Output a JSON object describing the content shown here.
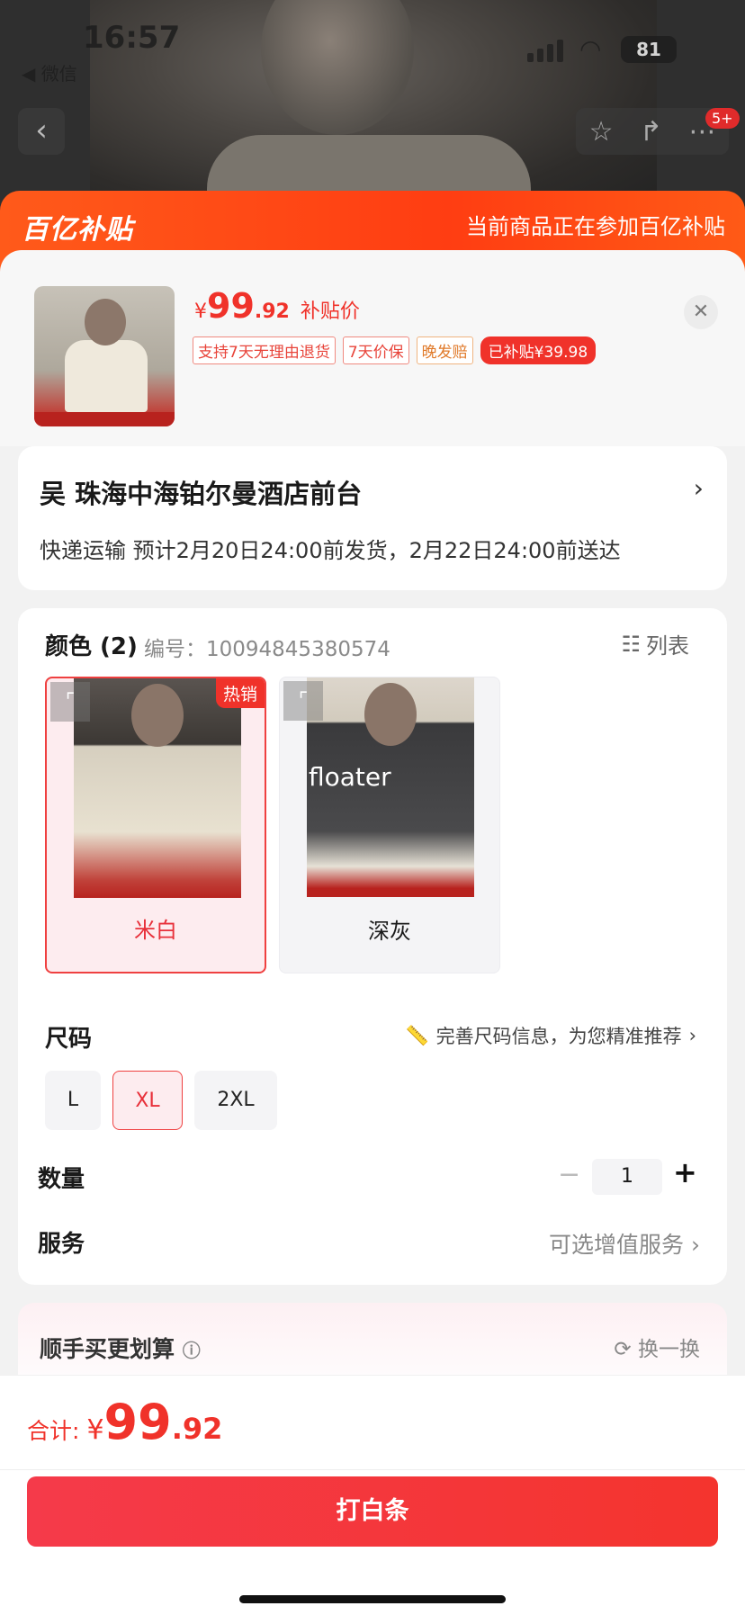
{
  "status": {
    "time": "16:57",
    "back_app": "◀ 微信",
    "battery": "81"
  },
  "nav": {
    "badge": "5+"
  },
  "banner": {
    "logo": "百亿补贴",
    "text": "当前商品正在参加百亿补贴"
  },
  "product": {
    "price_currency": "¥",
    "price_int": "99",
    "price_dec": ".92",
    "price_label": "补贴价",
    "tags": [
      "支持7天无理由退货",
      "7天价保",
      "晚发赔",
      "已补贴¥39.98"
    ]
  },
  "address": {
    "name": "吴  珠海中海铂尔曼酒店前台",
    "shipping": "快递运输 预计2月20日24:00前发货，2月22日24:00前送达"
  },
  "spec": {
    "color_title": "颜色 (2)",
    "sku": "编号：10094845380574",
    "list_label": "列表",
    "colors": [
      {
        "label": "米白",
        "hot": "热销",
        "selected": true
      },
      {
        "label": "深灰",
        "overlay": "floater",
        "selected": false
      }
    ],
    "size_title": "尺码",
    "size_hint": "完善尺码信息，为您精准推荐",
    "sizes": [
      "L",
      "XL",
      "2XL"
    ],
    "selected_size": "XL",
    "qty_title": "数量",
    "qty_value": "1",
    "service_title": "服务",
    "service_value": "可选增值服务"
  },
  "extra": {
    "title": "顺手买更划算",
    "refresh": "换一换"
  },
  "footer": {
    "total_label": "合计:",
    "currency": "¥",
    "total_int": "99",
    "total_dec": ".92",
    "pay_button": "打白条"
  },
  "colors": {
    "accent": "#f0322a",
    "banner": "#ff4a15",
    "selected_bg": "#fdecef"
  }
}
